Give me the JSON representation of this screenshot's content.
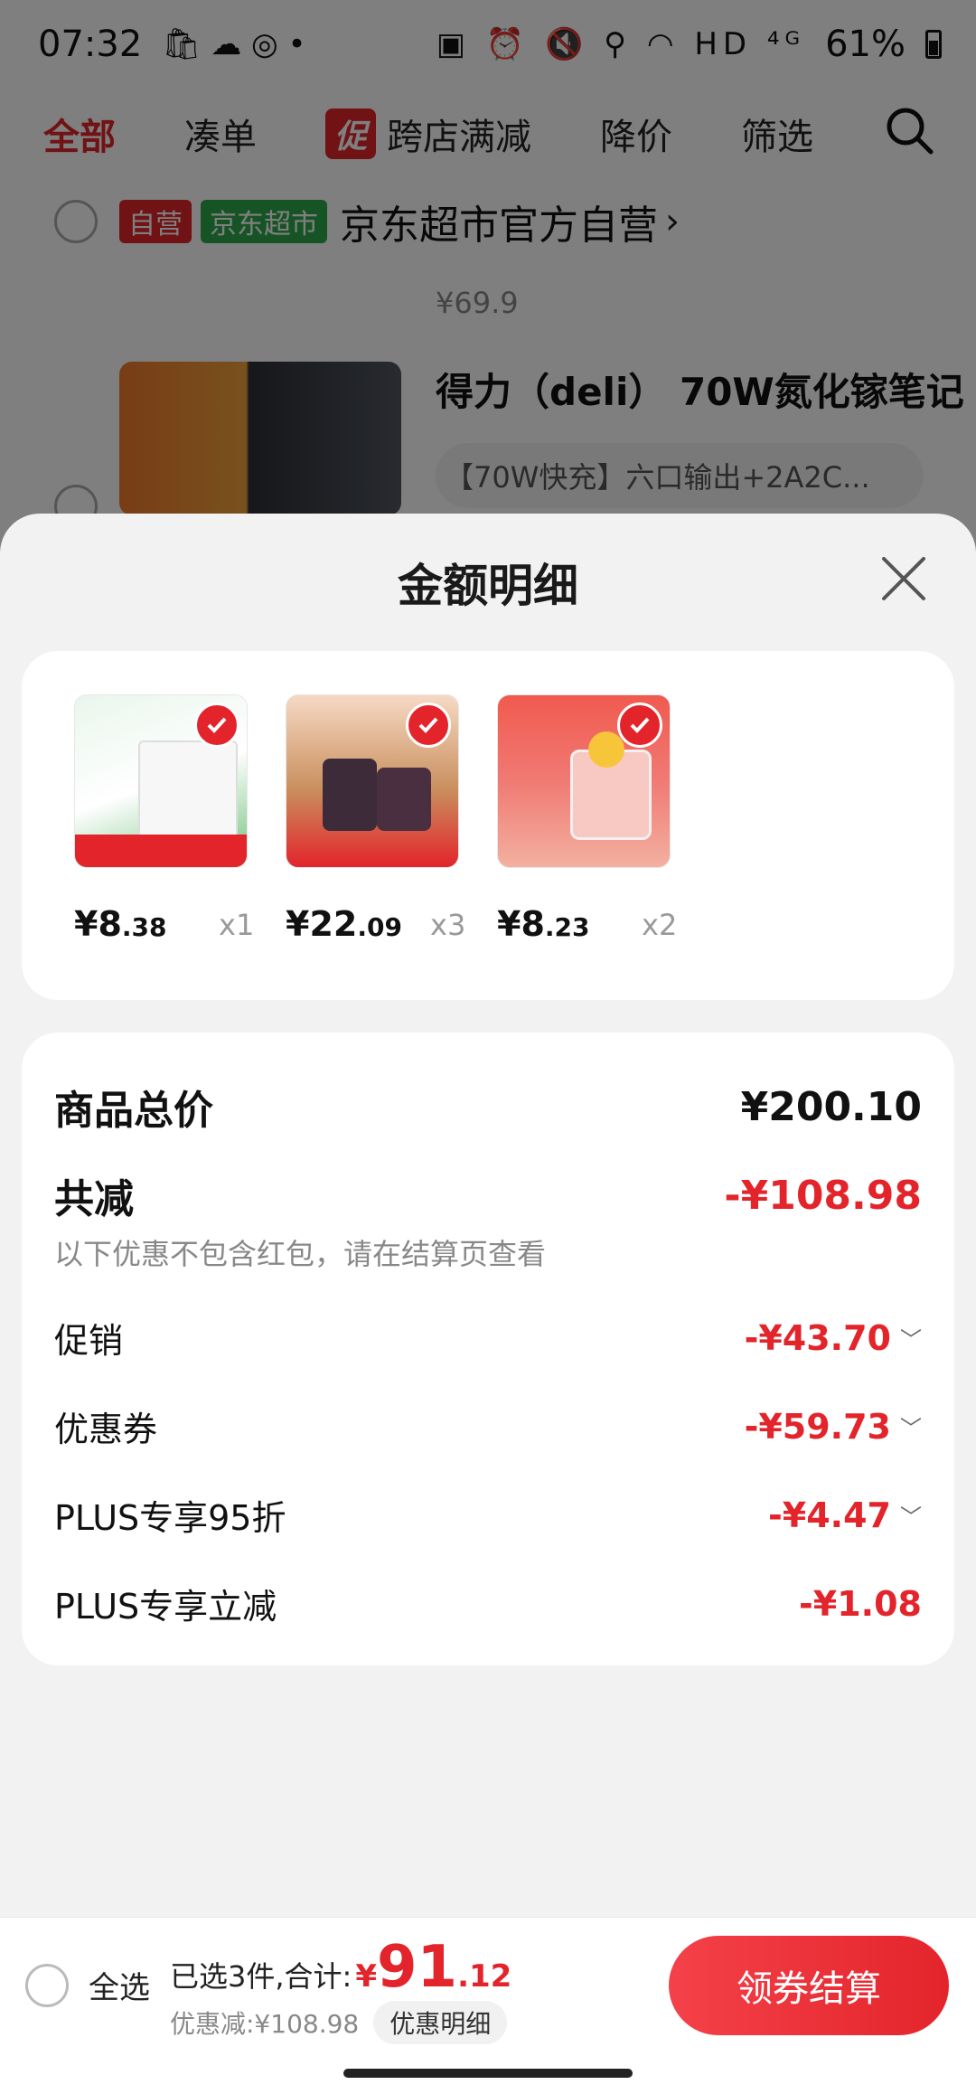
{
  "status_bar": {
    "time": "07:32",
    "battery": "61%",
    "icons": "▣ ⏰ 🔇 ⚲ ◠ HD ⁴ᴳ"
  },
  "nav": {
    "tabs": [
      "全部",
      "凑单",
      "跨店满减",
      "降价",
      "筛选"
    ],
    "promo_badge": "促"
  },
  "background": {
    "shop_tags": [
      "自营",
      "京东超市"
    ],
    "shop_name": "京东超市官方自营",
    "prev_price": "¥69.9",
    "product_title": "得力（deli） 70W氮化镓笔记",
    "product_spec": "【70W快充】六口输出+2A2C..."
  },
  "sheet": {
    "title": "金额明细",
    "items": [
      {
        "price_int": "¥8",
        "price_dec": ".38",
        "qty": "x1",
        "thumb_color": "#6fc07a"
      },
      {
        "price_int": "¥22",
        "price_dec": ".09",
        "qty": "x3",
        "thumb_color": "#c98f5d"
      },
      {
        "price_int": "¥8",
        "price_dec": ".23",
        "qty": "x2",
        "thumb_color": "#f07a74"
      }
    ],
    "summary": {
      "goods_total_label": "商品总价",
      "goods_total_value": "¥200.10",
      "reduce_label": "共减",
      "reduce_value": "-¥108.98",
      "note": "以下优惠不包含红包，请在结算页查看",
      "rows": [
        {
          "label": "促销",
          "value": "-¥43.70"
        },
        {
          "label": "优惠券",
          "value": "-¥59.73"
        },
        {
          "label": "PLUS专享95折",
          "value": "-¥4.47"
        },
        {
          "label": "PLUS专享立减",
          "value": "-¥1.08"
        }
      ]
    }
  },
  "bottom_bar": {
    "select_all": "全选",
    "selected_text": "已选3件,合计:",
    "total_currency": "¥",
    "total_int": "91",
    "total_dec": ".12",
    "discount_text": "优惠减:¥108.98",
    "detail_chip": "优惠明细",
    "checkout": "领券结算"
  }
}
